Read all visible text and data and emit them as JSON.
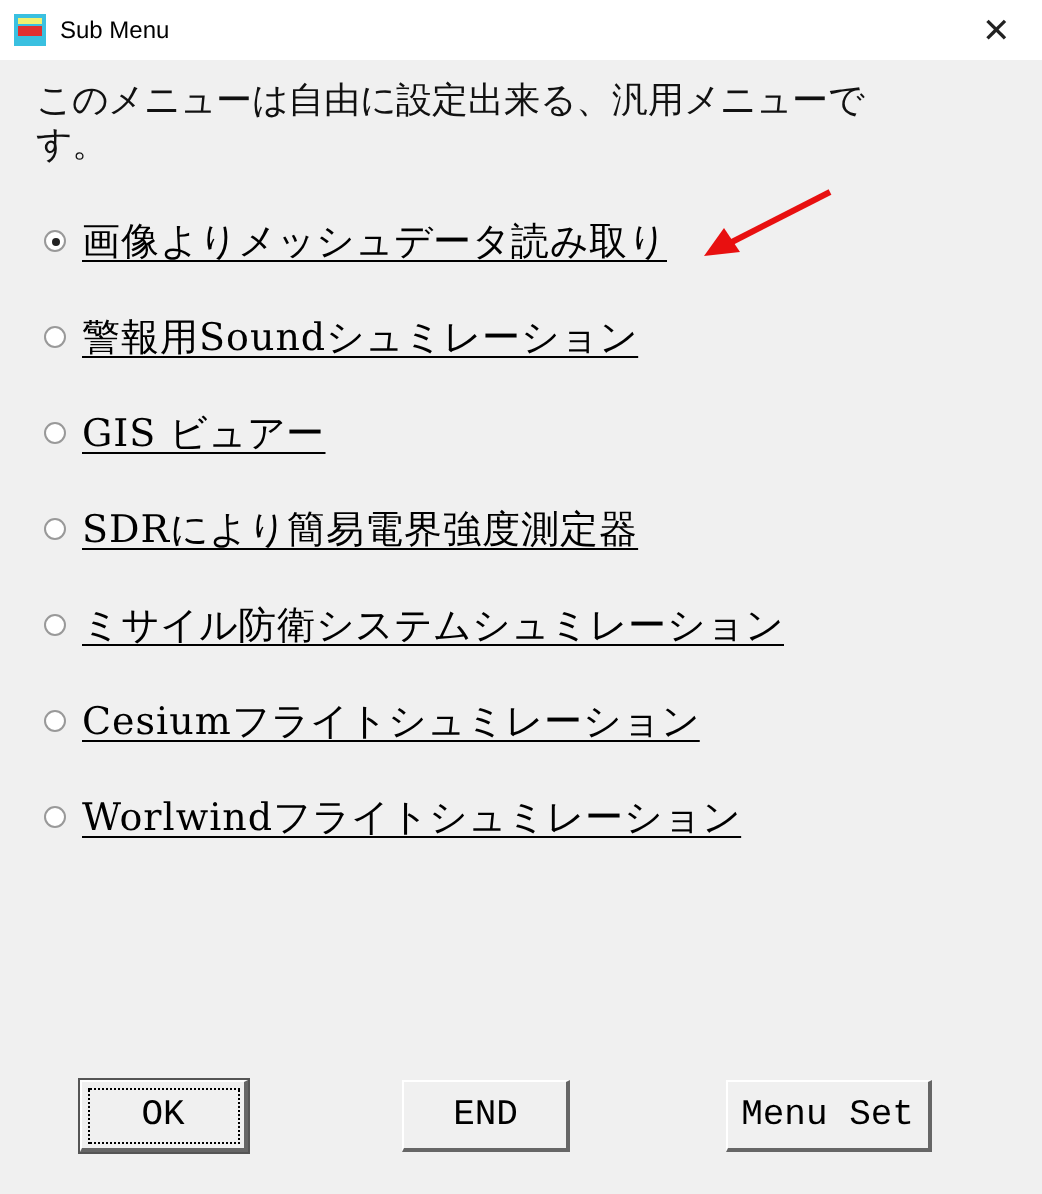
{
  "window": {
    "title": "Sub Menu",
    "close": "✕"
  },
  "description": "このメニューは自由に設定出来る、汎用メニューです。",
  "options": [
    {
      "label": "画像よりメッシュデータ読み取り",
      "selected": true
    },
    {
      "label": "警報用Soundシュミレーション",
      "selected": false
    },
    {
      "label": "GIS ビュアー",
      "selected": false
    },
    {
      "label": "SDRにより簡易電界強度測定器",
      "selected": false
    },
    {
      "label": "ミサイル防衛システムシュミレーション",
      "selected": false
    },
    {
      "label": "Cesiumフライトシュミレーション",
      "selected": false
    },
    {
      "label": "Worlwindフライトシュミレーション",
      "selected": false
    }
  ],
  "buttons": [
    {
      "label": "OK",
      "default": true
    },
    {
      "label": "END",
      "default": false
    },
    {
      "label": "Menu Set",
      "default": false
    }
  ]
}
